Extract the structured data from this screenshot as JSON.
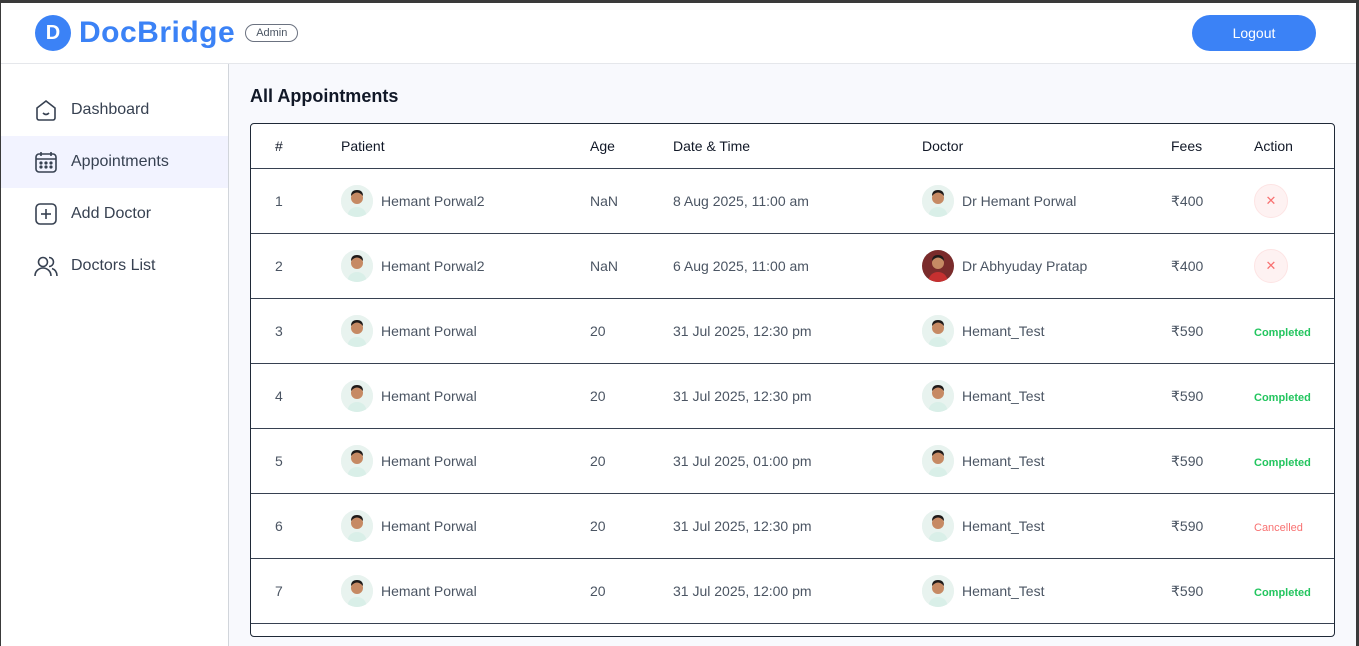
{
  "brand": {
    "logo_letter": "D",
    "name": "DocBridge",
    "role": "Admin"
  },
  "header": {
    "logout_label": "Logout"
  },
  "sidebar": {
    "items": [
      {
        "label": "Dashboard",
        "icon": "home-icon",
        "active": false
      },
      {
        "label": "Appointments",
        "icon": "calendar-icon",
        "active": true
      },
      {
        "label": "Add Doctor",
        "icon": "plus-square-icon",
        "active": false
      },
      {
        "label": "Doctors List",
        "icon": "people-icon",
        "active": false
      }
    ]
  },
  "main": {
    "title": "All Appointments",
    "columns": [
      "#",
      "Patient",
      "Age",
      "Date & Time",
      "Doctor",
      "Fees",
      "Action"
    ],
    "rows": [
      {
        "num": "1",
        "patient": "Hemant Porwal2",
        "age": "NaN",
        "datetime": "8 Aug 2025, 11:00 am",
        "doctor": "Dr Hemant Porwal",
        "fees": "₹400",
        "action": "cancel",
        "action_label": "✕"
      },
      {
        "num": "2",
        "patient": "Hemant Porwal2",
        "age": "NaN",
        "datetime": "6 Aug 2025, 11:00 am",
        "doctor": "Dr Abhyuday Pratap",
        "fees": "₹400",
        "action": "cancel",
        "action_label": "✕"
      },
      {
        "num": "3",
        "patient": "Hemant Porwal",
        "age": "20",
        "datetime": "31 Jul 2025, 12:30 pm",
        "doctor": "Hemant_Test",
        "fees": "₹590",
        "action": "completed",
        "action_label": "Completed"
      },
      {
        "num": "4",
        "patient": "Hemant Porwal",
        "age": "20",
        "datetime": "31 Jul 2025, 12:30 pm",
        "doctor": "Hemant_Test",
        "fees": "₹590",
        "action": "completed",
        "action_label": "Completed"
      },
      {
        "num": "5",
        "patient": "Hemant Porwal",
        "age": "20",
        "datetime": "31 Jul 2025, 01:00 pm",
        "doctor": "Hemant_Test",
        "fees": "₹590",
        "action": "completed",
        "action_label": "Completed"
      },
      {
        "num": "6",
        "patient": "Hemant Porwal",
        "age": "20",
        "datetime": "31 Jul 2025, 12:30 pm",
        "doctor": "Hemant_Test",
        "fees": "₹590",
        "action": "cancelled",
        "action_label": "Cancelled"
      },
      {
        "num": "7",
        "patient": "Hemant Porwal",
        "age": "20",
        "datetime": "31 Jul 2025, 12:00 pm",
        "doctor": "Hemant_Test",
        "fees": "₹590",
        "action": "completed",
        "action_label": "Completed"
      }
    ]
  },
  "colors": {
    "accent": "#3b82f6",
    "completed": "#22c55e",
    "cancelled": "#f87171"
  }
}
